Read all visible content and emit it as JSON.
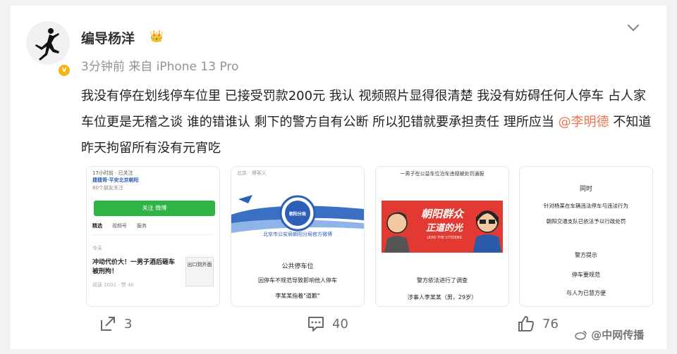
{
  "post": {
    "author": "编导杨洋",
    "time": "3分钟前",
    "source": "来自 iPhone 13 Pro",
    "text_part1": "我没有停在划线停车位里 已接受罚款200元 我认 视频照片显得很清楚 我没有妨碍任何人停车 占人家车位更是无稽之谈 谁的错谁认 剩下的警方自有公断 所以犯错就要承担责任 理所应当 ",
    "mention": "@李明德",
    "text_part2": " 不知道昨天拘留所有没有元宵吃"
  },
  "images": {
    "img1": {
      "header": "17小时前 · 已关注",
      "account": "捷捷哥·平安北京朝阳",
      "followers": "80个朋友关注",
      "follow_btn": "关注 微博",
      "tabs": [
        "精选",
        "视频号",
        "服务"
      ],
      "day": "今天",
      "headline": "冲动代价大！一男子酒后砸车被刑拘！",
      "foot": "阅读 2001 · 赞 40",
      "stamp": "出口到外面"
    },
    "img2": {
      "header": "北京 · 博客义",
      "logo_text": "朝阳分局",
      "subtitle": "北京市公安局朝阳分局官方微博",
      "title": "公共停车位",
      "line1": "因停车不规范导致影响他人停车",
      "line2": "李某某指着\"道歉\""
    },
    "img3": {
      "header": "一男子在公益车位泊车违规被处罚通报",
      "banner": "朝阳群众",
      "banner2": "正道的光",
      "banner_small": "LEAD THE CITIZENS",
      "caption1": "警方依法进行了调查",
      "caption2": "涉事人李某某（男，29岁）"
    },
    "img4": {
      "title": "同时",
      "line1": "针对杨某在车辆违法停车与违法行为",
      "line2": "朝阳交通支队已依法予以行政处罚",
      "sub1": "警方提示",
      "sub2": "停车要规范",
      "sub3": "与人为已慧方便"
    }
  },
  "actions": {
    "share_count": "3",
    "comment_count": "40",
    "like_count": "76"
  },
  "watermark": "@中网传播",
  "colors": {
    "mention": "#eb7350",
    "follow_green": "#2fb344",
    "banner_red": "#e23a32",
    "verified": "#f5b318"
  }
}
